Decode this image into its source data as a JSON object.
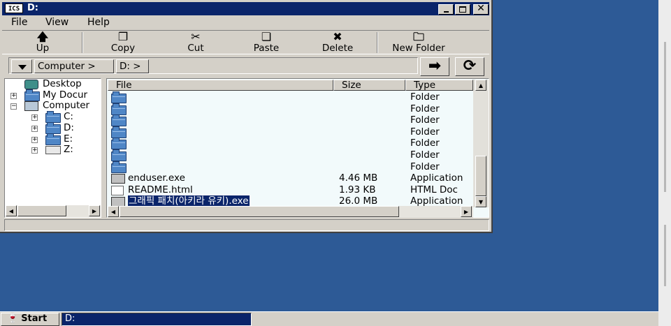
{
  "window": {
    "app_icon": "ICS",
    "title": "D:",
    "controls": {
      "minimize": "minimize-icon",
      "maximize": "maximize-icon",
      "close": "close-icon"
    }
  },
  "menu": [
    "File",
    "View",
    "Help"
  ],
  "toolbar": {
    "up": "Up",
    "copy": "Copy",
    "cut": "Cut",
    "paste": "Paste",
    "delete": "Delete",
    "new_folder": "New Folder"
  },
  "address": {
    "crumbs": [
      "Computer >",
      "D: >"
    ],
    "go_icon": "arrow-right-icon",
    "refresh_icon": "refresh-icon"
  },
  "tree": {
    "items": [
      {
        "label": "Desktop",
        "icon": "desktop-icon"
      },
      {
        "label": "My Docur",
        "icon": "documents-icon"
      },
      {
        "label": "Computer",
        "icon": "computer-icon"
      },
      {
        "label": "C:",
        "icon": "folder-icon"
      },
      {
        "label": "D:",
        "icon": "folder-icon"
      },
      {
        "label": "E:",
        "icon": "folder-icon"
      },
      {
        "label": "Z:",
        "icon": "drive-icon"
      }
    ]
  },
  "filelist": {
    "columns": [
      "File",
      "Size",
      "Type"
    ],
    "rows": [
      {
        "name": "",
        "size": "",
        "type": "Folder",
        "icon": "folder-icon"
      },
      {
        "name": "",
        "size": "",
        "type": "Folder",
        "icon": "folder-icon"
      },
      {
        "name": "",
        "size": "",
        "type": "Folder",
        "icon": "folder-icon"
      },
      {
        "name": "",
        "size": "",
        "type": "Folder",
        "icon": "folder-icon"
      },
      {
        "name": "",
        "size": "",
        "type": "Folder",
        "icon": "folder-icon"
      },
      {
        "name": "",
        "size": "",
        "type": "Folder",
        "icon": "folder-icon"
      },
      {
        "name": "",
        "size": "",
        "type": "Folder",
        "icon": "folder-icon"
      },
      {
        "name": "enduser.exe",
        "size": "4.46 MB",
        "type": "Application",
        "icon": "application-icon"
      },
      {
        "name": "README.html",
        "size": "1.93 KB",
        "type": "HTML Doc",
        "icon": "html-file-icon"
      },
      {
        "name": "그래픽 패치(아키라 유키).exe",
        "size": "26.0 MB",
        "type": "Application",
        "icon": "application-icon",
        "selected": true
      }
    ]
  },
  "taskbar": {
    "start": "Start",
    "task": "D:"
  },
  "colors": {
    "desktop": "#2d5a96",
    "titlebar": "#0a246a",
    "chrome": "#d4d0c8",
    "selection": "#0a246a"
  }
}
